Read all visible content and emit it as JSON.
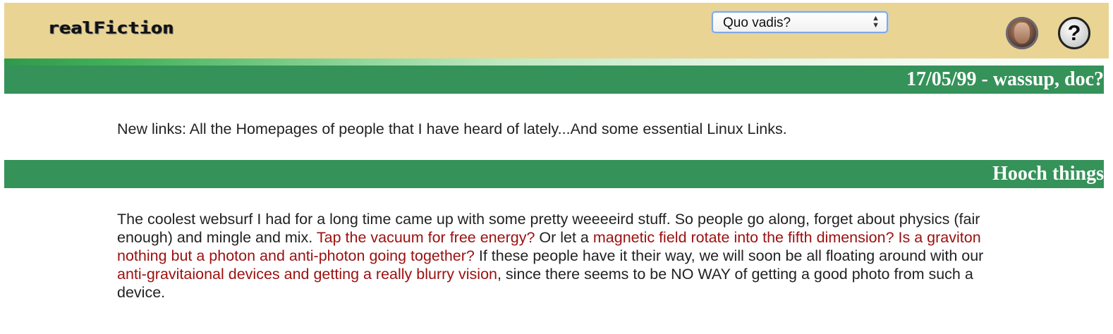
{
  "header": {
    "logo_text": "realFiction",
    "nav_select": {
      "selected": "Quo vadis?"
    },
    "colors": {
      "header_bg": "#ead494",
      "bar_green": "#359259",
      "link": "#9c0f0f"
    }
  },
  "news": {
    "date_heading": "17/05/99 - wassup, doc?",
    "links_text": "New links: All the Homepages of people that I have heard of lately...And some essential Linux Links."
  },
  "article": {
    "heading": "Hooch things",
    "t1": "The coolest websurf I had for a long time came up with some pretty weeeeird stuff. So people go along, forget about physics (fair enough) and mingle and mix. ",
    "l1": "Tap the vacuum for free energy?",
    "t2": " Or let a ",
    "l2": "magnetic field rotate into the fifth dimension?",
    "t3": " ",
    "l3": "Is a graviton nothing but a photon and anti-photon going together?",
    "t4": " If these people have it their way, we will soon be all floating around with our ",
    "l4": "anti-gravitaional devices and getting a really blurry vision",
    "t5": ", since there seems to be NO WAY of getting a good photo from such a device."
  }
}
